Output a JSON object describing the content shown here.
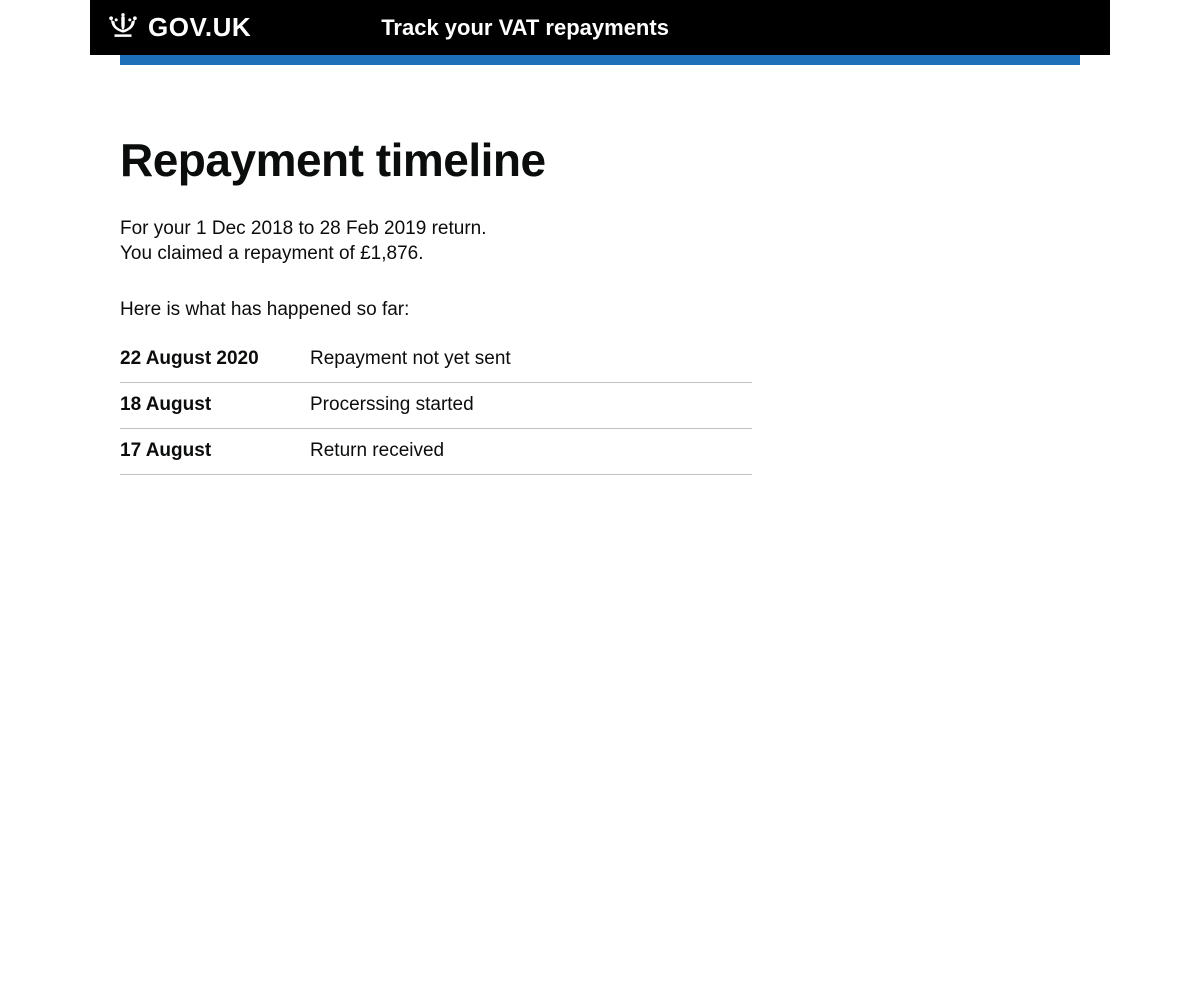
{
  "header": {
    "site_name": "GOV.UK",
    "service_name": "Track your VAT repayments"
  },
  "main": {
    "title": "Repayment timeline",
    "intro_line1": "For your 1 Dec 2018 to 28 Feb 2019 return.",
    "intro_line2": "You claimed a repayment of £1,876.",
    "sofar": "Here is what has happened so far:",
    "timeline": [
      {
        "date": "22 August 2020",
        "status": "Repayment not yet sent"
      },
      {
        "date": "18 August",
        "status": "Procerssing started"
      },
      {
        "date": "17 August",
        "status": "Return received"
      }
    ]
  }
}
